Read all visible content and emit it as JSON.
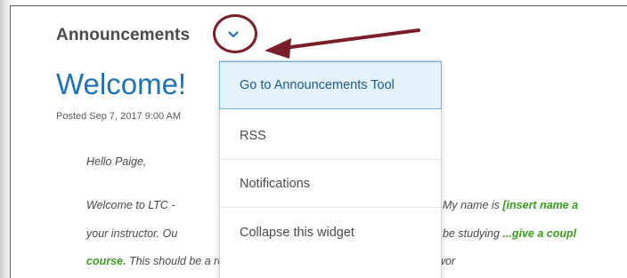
{
  "widget": {
    "title": "Announcements",
    "chevron_icon": "chevron-down-icon"
  },
  "post": {
    "title": "Welcome!",
    "meta": "Posted Sep 7, 2017 9:00 AM",
    "greeting": "Hello Paige,",
    "line1_start": "Welcome to LTC -",
    "line1_end": "My name is ",
    "line1_green": "[insert name a",
    "line2_start": "your instructor. Ou",
    "line2_end": "be studying ",
    "line2_green": "...give a coupl",
    "line3_green": "course.",
    "line3_rest": "  This should be a really exciting semester and I look forward to wor"
  },
  "menu": {
    "items": [
      "Go to Announcements Tool",
      "RSS",
      "Notifications",
      "Collapse this widget"
    ]
  },
  "colors": {
    "link_blue": "#1e73b4",
    "highlight": "#7a1e28",
    "accent_green": "#3a9e1e"
  }
}
